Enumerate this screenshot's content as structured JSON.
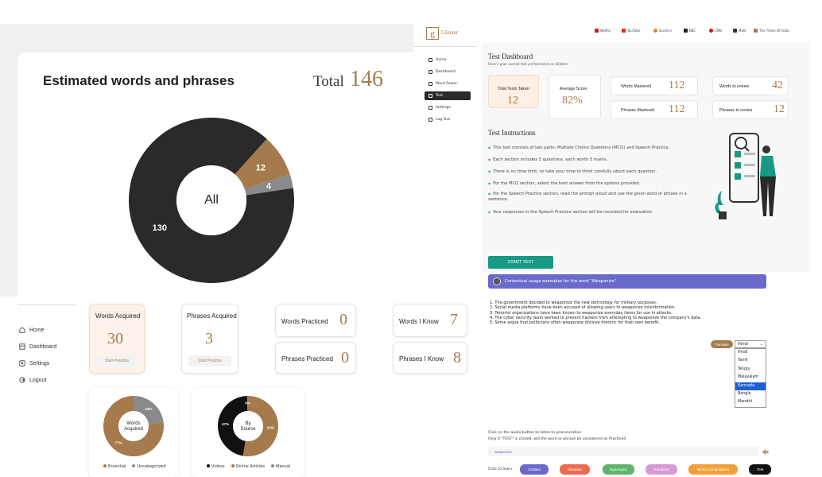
{
  "estimate": {
    "title": "Estimated words and phrases",
    "total_label": "Total",
    "total_value": "146",
    "center_label": "All",
    "slices": [
      {
        "label": "130",
        "value": 130,
        "color": "#2a2a2a"
      },
      {
        "label": "12",
        "value": 12,
        "color": "#a57b4d"
      },
      {
        "label": "4",
        "value": 4,
        "color": "#8a8a8a"
      }
    ]
  },
  "dash": {
    "header_left": "",
    "header_right": "",
    "sidebar": [
      "Home",
      "Dashboard",
      "Settings",
      "Logout"
    ],
    "cards": {
      "words_acquired": {
        "label": "Words Acquired",
        "value": "30",
        "button": "Start Practice"
      },
      "phrases_acquired": {
        "label": "Phrases Acquired",
        "value": "3",
        "button": "Start Practice"
      },
      "words_practiced": {
        "label": "Words Practiced",
        "value": "0"
      },
      "phrases_practiced": {
        "label": "Phrases Practiced",
        "value": "0"
      },
      "words_i_know": {
        "label": "Words I Know",
        "value": "7"
      },
      "phrases_i_know": {
        "label": "Phrases I Know",
        "value": "8"
      }
    },
    "donut1": {
      "center": [
        "Words",
        "Acquired"
      ],
      "slices": [
        {
          "label": "77%",
          "value": 77,
          "color": "#a57b4d",
          "name": "Essential"
        },
        {
          "label": "23%",
          "value": 23,
          "color": "#8a8a8a",
          "name": "Uncategorized"
        }
      ]
    },
    "donut2": {
      "center": [
        "By",
        "Source"
      ],
      "slices": [
        {
          "label": "53%",
          "value": 53,
          "color": "#a57b4d",
          "name": "Online Articles"
        },
        {
          "label": "47%",
          "value": 47,
          "color": "#111111",
          "name": "Videos"
        },
        {
          "label": "0%",
          "value": 0.5,
          "color": "#8a8a8a",
          "name": "Manual"
        }
      ],
      "legend": [
        "Videos",
        "Online Articles",
        "Manual"
      ]
    }
  },
  "test": {
    "brand": "Glitster",
    "sidebar": [
      "Home",
      "Dashboard",
      "Word Power",
      "Test",
      "Settings",
      "Log Out"
    ],
    "topnav": [
      {
        "label": "Netflix",
        "color": "#d31a1a"
      },
      {
        "label": "YouTube",
        "color": "#e22"
      },
      {
        "label": "Scroll.in",
        "color": "#e9862a"
      },
      {
        "label": "BBC",
        "color": "#222"
      },
      {
        "label": "CNN",
        "color": "#d11"
      },
      {
        "label": "MSN",
        "color": "#333"
      },
      {
        "label": "The Times Of India",
        "color": "#a57b4d"
      }
    ],
    "title": "Test Dashboard",
    "subtitle": "Here's your overall test performance on Glitster",
    "cards": {
      "total_tests": {
        "label": "Total Tests Taken",
        "value": "12"
      },
      "average": {
        "label": "Average Score",
        "value": "82%"
      },
      "words_mastered": {
        "label": "Words Mastered",
        "value": "112"
      },
      "phrases_mastered": {
        "label": "Phrases Mastered",
        "value": "112"
      },
      "words_review": {
        "label": "Words to review",
        "value": "42"
      },
      "phrases_review": {
        "label": "Phrases to review",
        "value": "12"
      }
    },
    "instructions_title": "Test Instructions",
    "instructions": [
      "This test consists of two parts: Multiple Choice Questions (MCQ) and Speech Practice.",
      "Each section includes 5 questions, each worth 5 marks.",
      "There is no time limit, so take your time to think carefully about each question.",
      "For the MCQ section, select the best answer from the options provided.",
      "For the Speech Practice section, read the prompt aloud and use the given word or phrase in a sentence.",
      "Your responses in the Speech Practice section will be recorded for evaluation."
    ],
    "start_button": "START TEST"
  },
  "usage": {
    "header": "Contextual usage examples for the word \"Weaponize\"",
    "examples": [
      "1. The government decided to weaponize the new technology for military purposes.",
      "2. Social media platforms have been accused of allowing users to weaponize misinformation.",
      "3. Terrorist organizations have been known to weaponize everyday items for use in attacks.",
      "4. The cyber security team worked to prevent hackers from attempting to weaponize the company's data.",
      "5. Some argue that politicians often weaponize divisive rhetoric for their own benefit."
    ],
    "translate_label": "Translate",
    "selected_language": "Hindi",
    "languages": [
      "Hindi",
      "Tamil",
      "Telugu",
      "Malayalam",
      "Kannada",
      "Bangla",
      "Marathi"
    ],
    "highlighted_language": "Kannada",
    "hint1": "Click on the audio button to listen to pronunciation",
    "hint2": "Only if \"TEST\" is clicked, will the word or phrase be considered as Practiced",
    "input_value": "weaponize",
    "learn_label": "Click to learn",
    "learn_buttons": [
      {
        "label": "Context",
        "color": "#6a6acb"
      },
      {
        "label": "Situation",
        "color": "#ec6a4f"
      },
      {
        "label": "Synonyms",
        "color": "#5db46a"
      },
      {
        "label": "Emotions",
        "color": "#d69ad8"
      },
      {
        "label": "Word Combinations",
        "color": "#f0a23a"
      },
      {
        "label": "Test",
        "color": "#111111"
      }
    ]
  }
}
